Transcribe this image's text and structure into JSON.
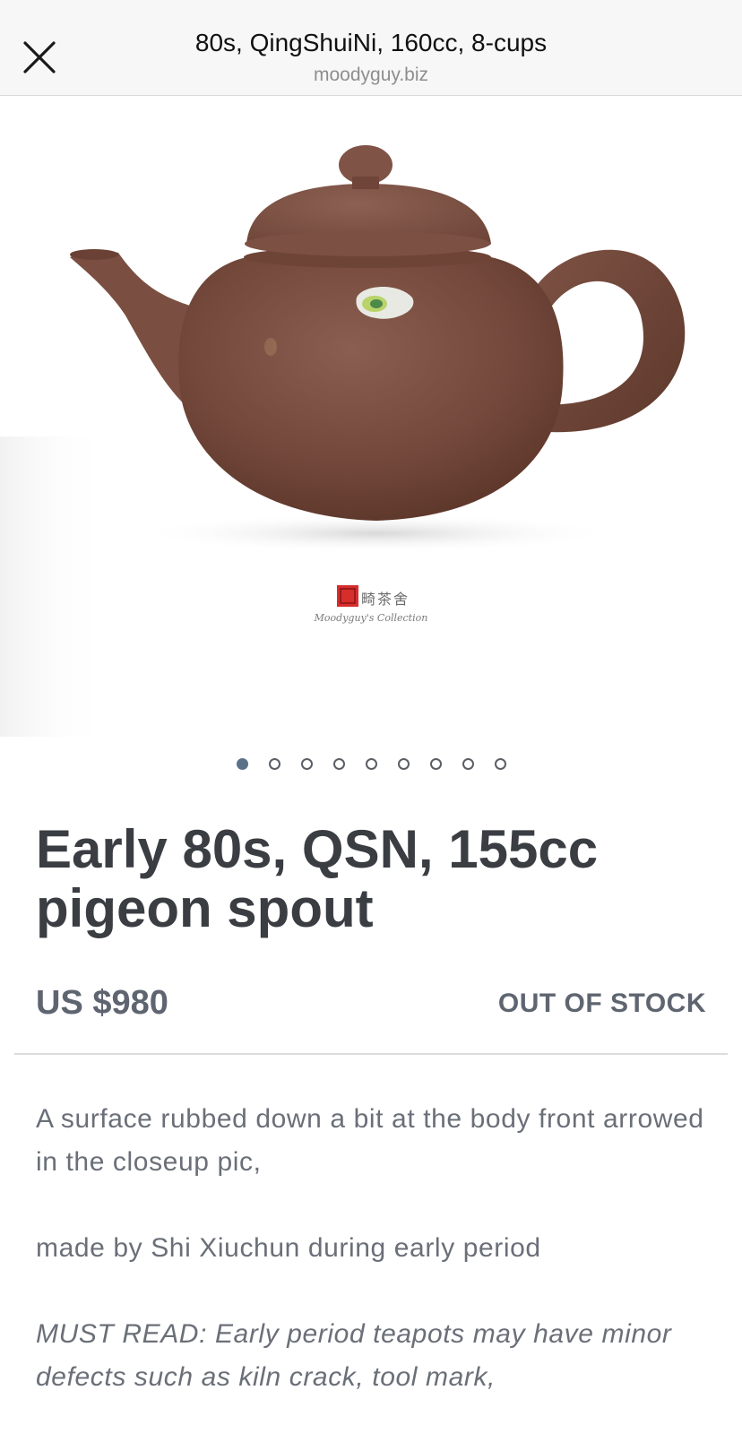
{
  "topbar": {
    "title": "80s, QingShuiNi, 160cc, 8-cups",
    "domain": "moodyguy.biz"
  },
  "hero": {
    "image": "teapot-photo",
    "watermark": {
      "chinese": "藏 畸茶舍",
      "caption": "Moodyguy's Collection"
    }
  },
  "carousel": {
    "count": 9,
    "active_index": 0
  },
  "product": {
    "title": "Early 80s, QSN, 155cc pigeon spout",
    "price": "US $980",
    "stock_status": "OUT OF STOCK"
  },
  "description": {
    "p1": "A surface rubbed down a bit at the body front arrowed in the closeup pic,",
    "p2": "made by Shi Xiuchun during early period",
    "p3": "MUST READ: Early period teapots may have minor defects such as kiln crack, tool mark,"
  },
  "colors": {
    "clay": "#7b5043",
    "text_dark": "#3a3d42",
    "text_muted": "#5f6570",
    "dot_active": "#5a7188"
  }
}
